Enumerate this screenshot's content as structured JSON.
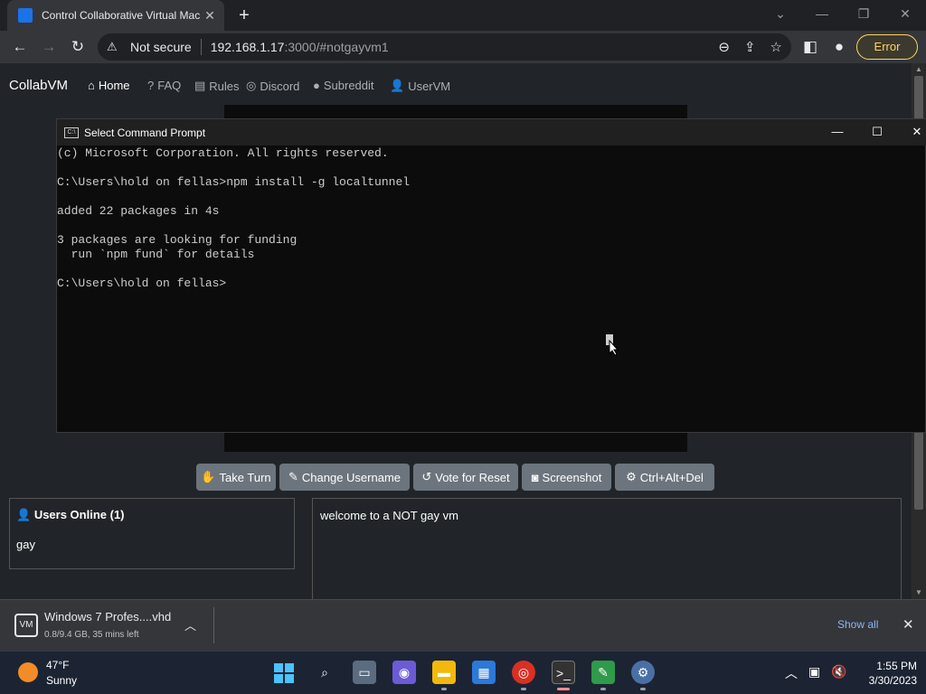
{
  "browser": {
    "tab_title": "Control Collaborative Virtual Mac",
    "new_tab": "+",
    "security_label": "Not secure",
    "url_host": "192.168.1.17",
    "url_path": ":3000/#notgayvm1",
    "error_label": "Error"
  },
  "site": {
    "brand": "CollabVM",
    "nav": [
      {
        "label": "Home",
        "icon": "home-icon"
      },
      {
        "label": "FAQ",
        "icon": "question-icon"
      },
      {
        "label": "Rules",
        "icon": "clipboard-icon"
      },
      {
        "label": "Discord",
        "icon": "discord-icon"
      },
      {
        "label": "Subreddit",
        "icon": "reddit-icon"
      },
      {
        "label": "UserVM",
        "icon": "user-icon"
      }
    ],
    "buttons": [
      {
        "label": "Take Turn",
        "icon": "hand-icon"
      },
      {
        "label": "Change Username",
        "icon": "user-edit-icon"
      },
      {
        "label": "Vote for Reset",
        "icon": "undo-icon"
      },
      {
        "label": "Screenshot",
        "icon": "camera-icon"
      },
      {
        "label": "Ctrl+Alt+Del",
        "icon": "gear-icon"
      }
    ],
    "users_header": "Users Online (1)",
    "users": [
      "gay"
    ],
    "chat_messages": [
      "welcome to a NOT gay vm"
    ]
  },
  "cmd": {
    "title": "Select Command Prompt",
    "lines": [
      "(c) Microsoft Corporation. All rights reserved.",
      "",
      "C:\\Users\\hold on fellas>npm install -g localtunnel",
      "",
      "added 22 packages in 4s",
      "",
      "3 packages are looking for funding",
      "  run `npm fund` for details",
      "",
      "C:\\Users\\hold on fellas>"
    ]
  },
  "download": {
    "filename": "Windows 7 Profes....vhd",
    "progress": "0.8/9.4 GB, 35 mins left",
    "show_all": "Show all"
  },
  "taskbar": {
    "temperature": "47°F",
    "condition": "Sunny",
    "time": "1:55 PM",
    "date": "3/30/2023"
  }
}
